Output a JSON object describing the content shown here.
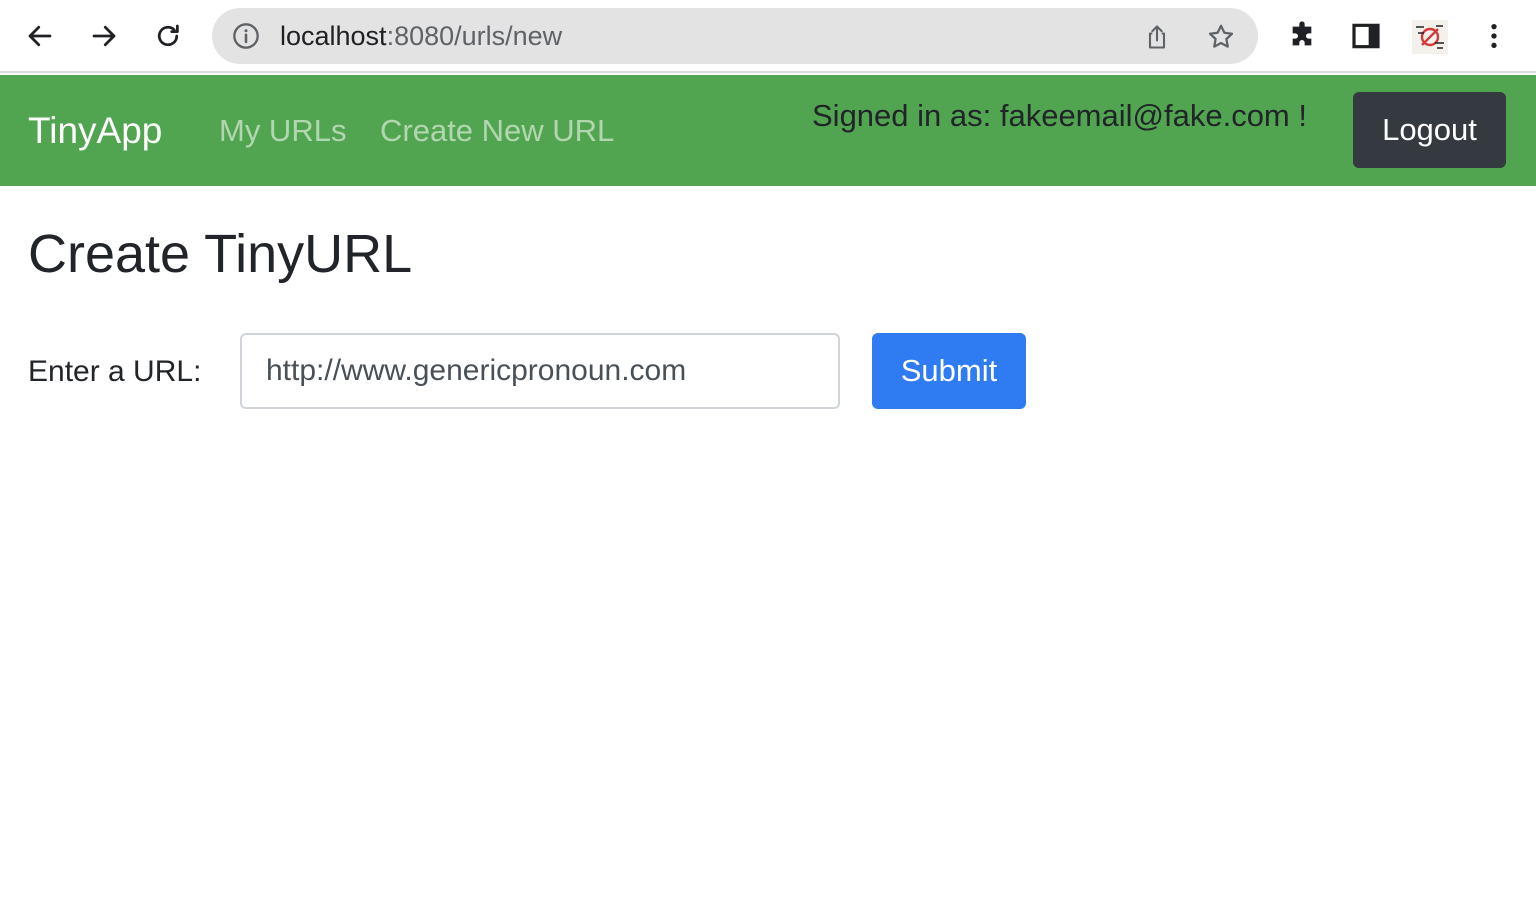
{
  "browser": {
    "url_host": "localhost",
    "url_rest": ":8080/urls/new",
    "icons": [
      "back-arrow-icon",
      "forward-arrow-icon",
      "reload-icon",
      "info-icon",
      "share-icon",
      "bookmark-star-icon",
      "extensions-puzzle-icon",
      "side-panel-icon",
      "profile-avatar",
      "more-vert-icon"
    ]
  },
  "navbar": {
    "brand": "TinyApp",
    "links": [
      "My URLs",
      "Create New URL"
    ],
    "signed_in_text": "Signed in as: fakeemail@fake.com !",
    "logout_label": "Logout",
    "background": "#52a550"
  },
  "main": {
    "title": "Create TinyURL",
    "url_label": "Enter a URL:",
    "url_placeholder": "http://www.genericpronoun.com",
    "submit_label": "Submit",
    "submit_color": "#2f7bf2"
  }
}
